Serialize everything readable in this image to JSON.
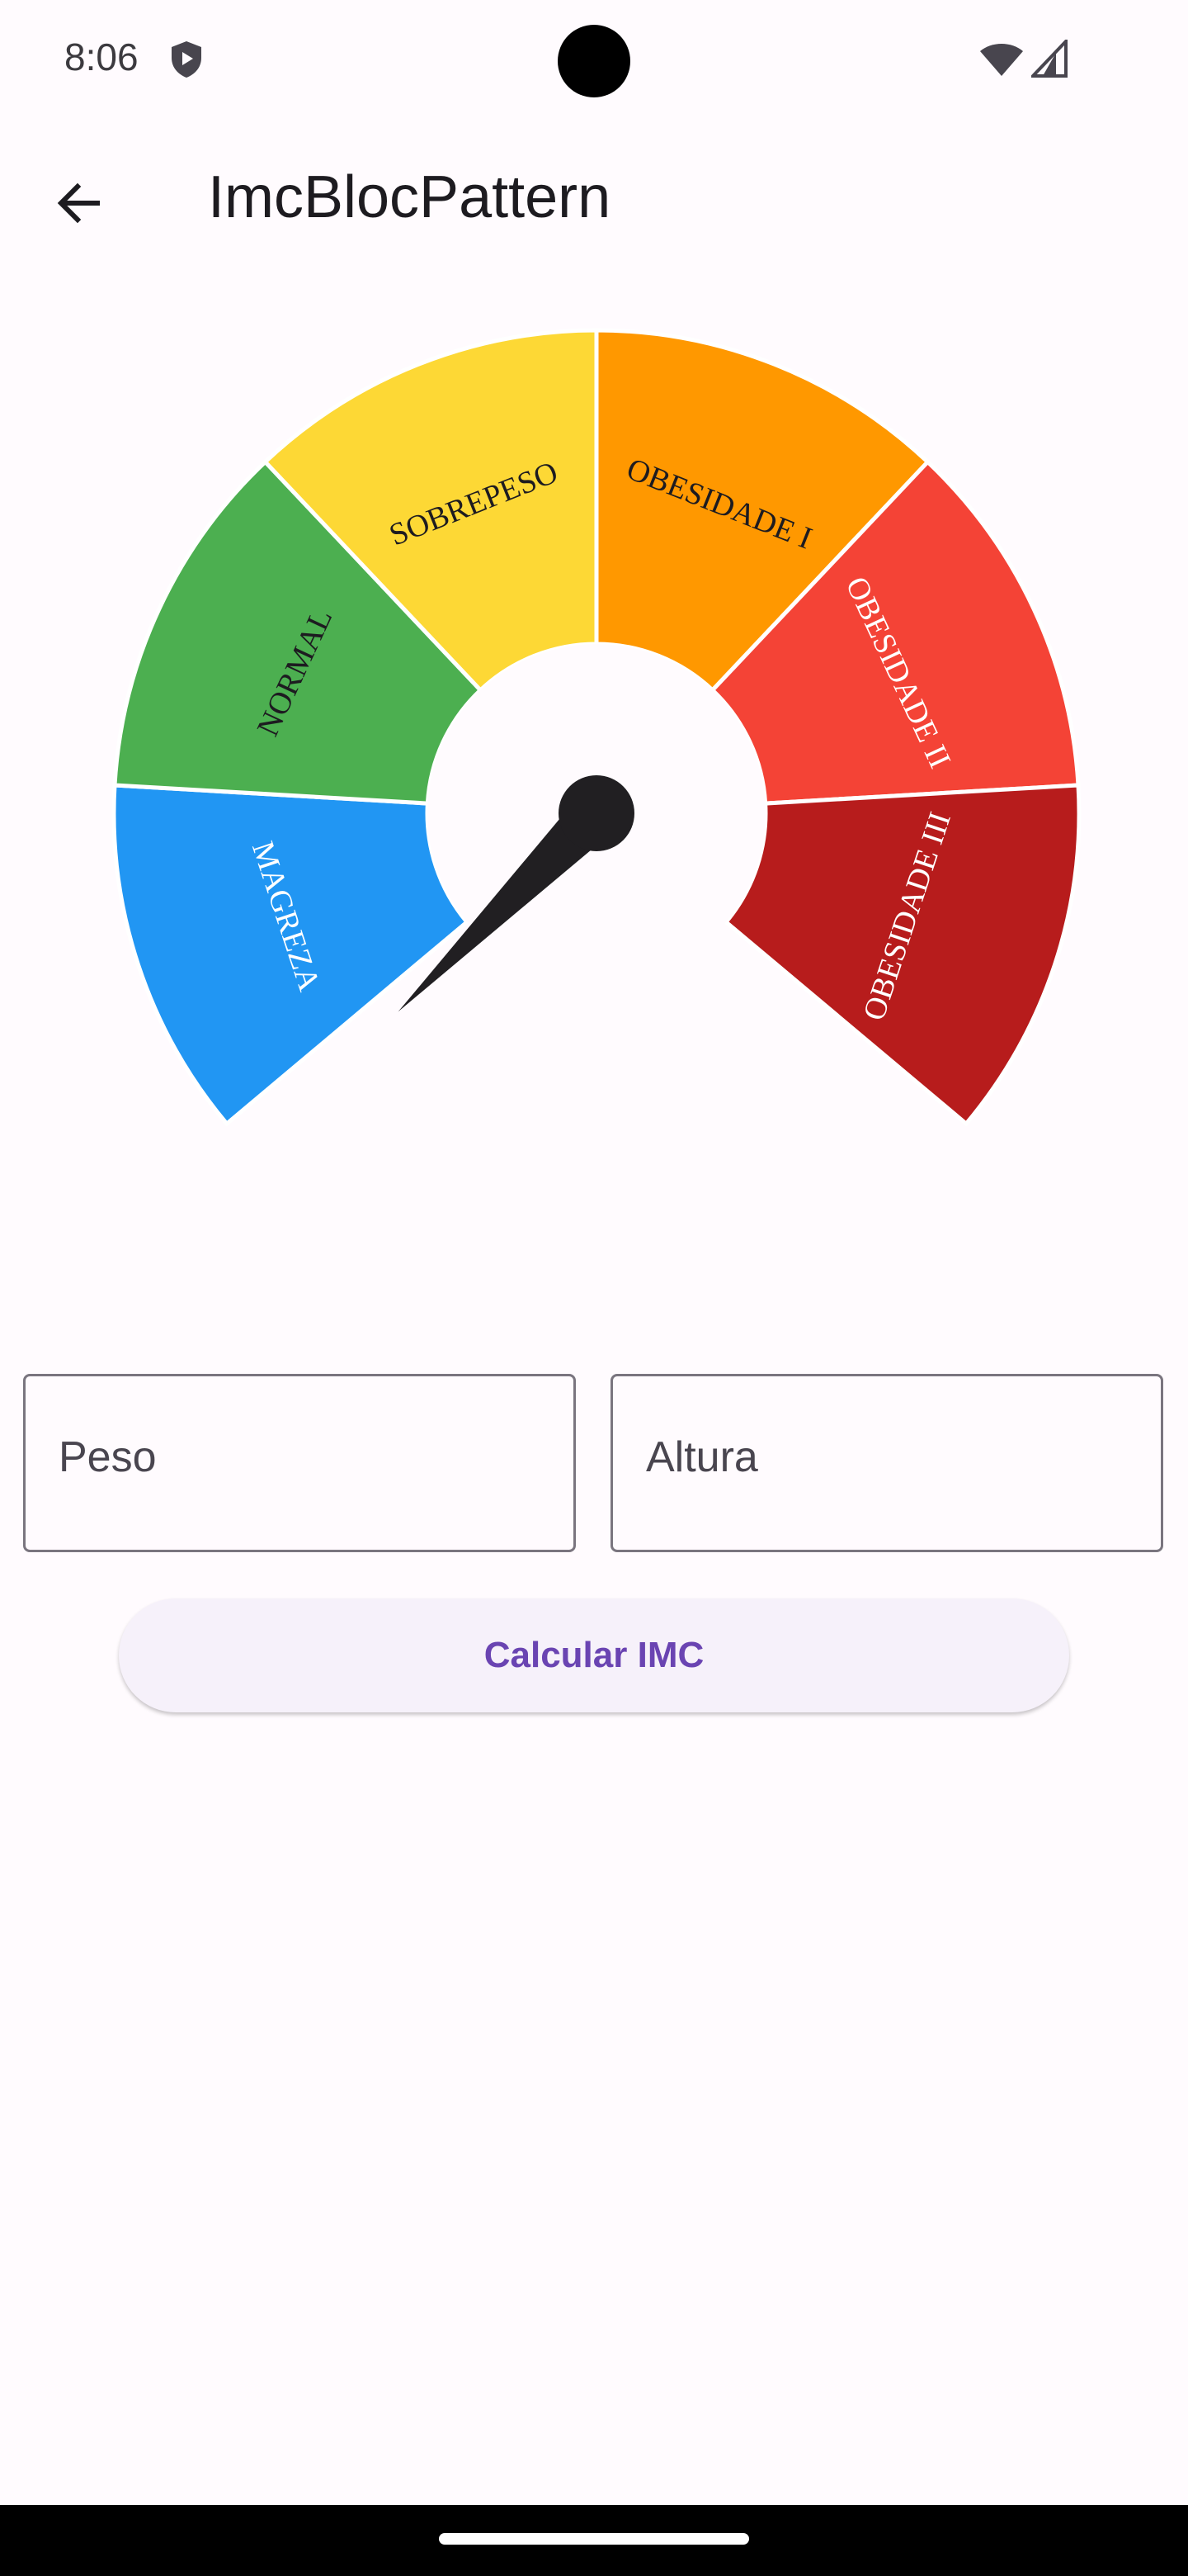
{
  "status_bar": {
    "time": "8:06",
    "icons": [
      "shield-icon",
      "wifi-icon",
      "signal-icon"
    ]
  },
  "app_bar": {
    "back_icon": "arrow-back-icon",
    "title": "ImcBlocPattern"
  },
  "gauge": {
    "segments": [
      {
        "label": "MAGREZA",
        "color": "#2196f3",
        "text_color": "#ffffff"
      },
      {
        "label": "NORMAL",
        "color": "#4caf50",
        "text_color": "#1d1b20"
      },
      {
        "label": "SOBREPESO",
        "color": "#fdd835",
        "text_color": "#1d1b20"
      },
      {
        "label": "OBESIDADE I",
        "color": "#ff9800",
        "text_color": "#1d1b20"
      },
      {
        "label": "OBESIDADE II",
        "color": "#f44336",
        "text_color": "#ffffff"
      },
      {
        "label": "OBESIDADE III",
        "color": "#b71c1c",
        "text_color": "#ffffff"
      }
    ],
    "needle_color": "#211f22"
  },
  "form": {
    "peso_label": "Peso",
    "altura_label": "Altura",
    "calculate_label": "Calcular IMC"
  },
  "colors": {
    "background": "#fffbfe",
    "primary": "#6a44b2"
  }
}
